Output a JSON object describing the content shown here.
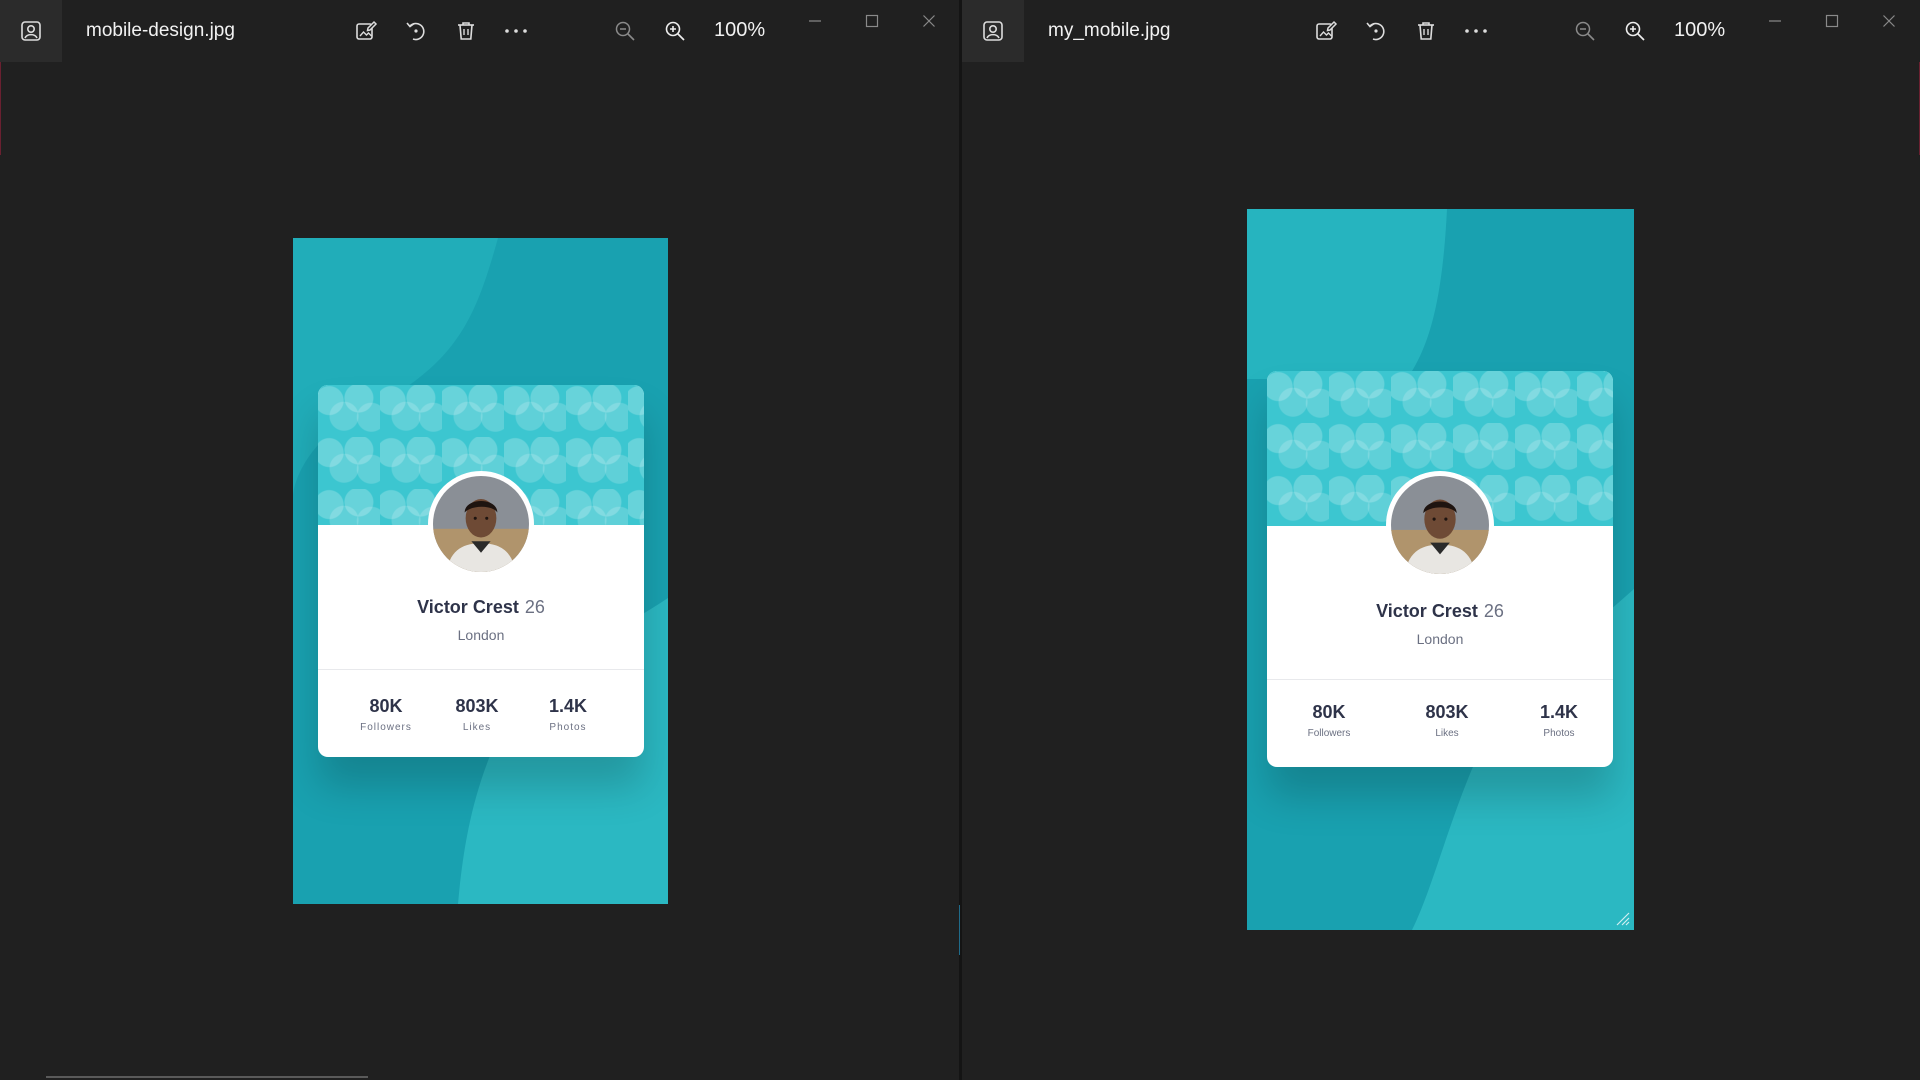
{
  "windows": [
    {
      "filename": "mobile-design.jpg",
      "zoom": "100%",
      "icons": {
        "app": "photos-app-icon",
        "edit": "edit-image-icon",
        "rotate": "rotate-icon",
        "delete": "delete-icon",
        "more": "more-icon",
        "zoom_out": "zoom-out-icon",
        "zoom_in": "zoom-in-icon",
        "minimize": "minimize-icon",
        "maximize": "maximize-icon",
        "close": "close-icon"
      },
      "profile": {
        "name": "Victor Crest",
        "age": "26",
        "city": "London",
        "stats": [
          {
            "value": "80K",
            "label": "Followers"
          },
          {
            "value": "803K",
            "label": "Likes"
          },
          {
            "value": "1.4K",
            "label": "Photos"
          }
        ]
      }
    },
    {
      "filename": "my_mobile.jpg",
      "zoom": "100%",
      "icons": {
        "app": "photos-app-icon",
        "edit": "edit-image-icon",
        "rotate": "rotate-icon",
        "delete": "delete-icon",
        "more": "more-icon",
        "zoom_out": "zoom-out-icon",
        "zoom_in": "zoom-in-icon",
        "minimize": "minimize-icon",
        "maximize": "maximize-icon",
        "close": "close-icon"
      },
      "profile": {
        "name": "Victor Crest",
        "age": "26",
        "city": "London",
        "stats": [
          {
            "value": "80K",
            "label": "Followers"
          },
          {
            "value": "803K",
            "label": "Likes"
          },
          {
            "value": "1.4K",
            "label": "Photos"
          }
        ]
      }
    }
  ],
  "colors": {
    "background": "#202020",
    "titlebar_tile": "#2b2b2b",
    "phone_bg": "#19a1b0",
    "phone_wave": "#2bb8c2",
    "card_banner": "#3cc6d0",
    "text_dark": "#2e3349",
    "text_muted": "#6b7082"
  }
}
